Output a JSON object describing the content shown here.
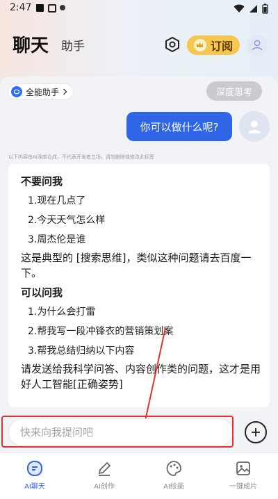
{
  "status_bar": {
    "time": "2:47"
  },
  "header": {
    "title": "聊天",
    "subtitle": "助手",
    "subscribe_label": "订阅"
  },
  "chat": {
    "assistant_chip": "全能助手",
    "deep_think": "深度思考",
    "user_message": "你可以做什么呢?",
    "disclaimer": "以下内容由AI深度合成，不代表开发者立场，请勿删除或修改此标签",
    "reply": {
      "section1_title": "不要问我",
      "section1_items": [
        "1.现在几点了",
        "2.今天天气怎么样",
        "3.周杰伦是谁"
      ],
      "section1_note": "这是典型的 [搜索思维]，类似这种问题请去百度一下。",
      "section2_title": "可以问我",
      "section2_items": [
        "1.为什么会打雷",
        "2.帮我写一段冲锋衣的营销策划案",
        "3.帮我总结归纳以下内容"
      ],
      "section2_note": "请发送给我科学问答、内容创作类的问题，这才是用好人工智能[正确姿势]"
    }
  },
  "input": {
    "placeholder": "快来向我提问吧"
  },
  "nav": {
    "items": [
      {
        "label": "AI聊天",
        "icon": "chat-bubble-icon",
        "active": true
      },
      {
        "label": "AI创作",
        "icon": "pen-icon",
        "active": false
      },
      {
        "label": "AI绘画",
        "icon": "palette-icon",
        "active": false
      },
      {
        "label": "一键成片",
        "icon": "image-icon",
        "active": false
      }
    ]
  },
  "colors": {
    "accent": "#2f66e8",
    "subscribe": "#f7c64f",
    "highlight": "#e2332e"
  }
}
